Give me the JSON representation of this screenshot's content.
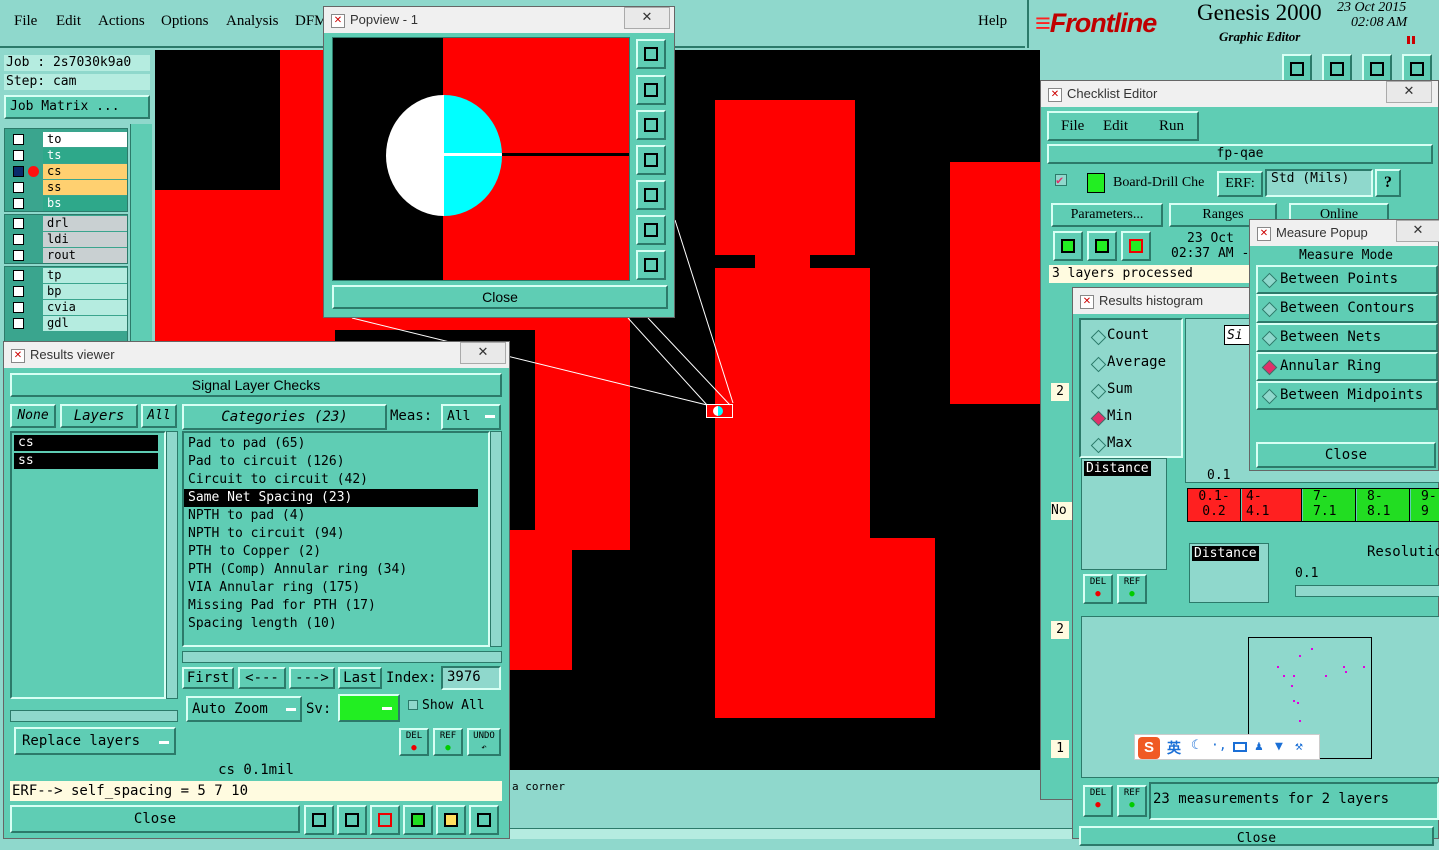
{
  "menubar": {
    "items": [
      "File",
      "Edit",
      "Actions",
      "Options",
      "Analysis",
      "DFM"
    ],
    "help": "Help"
  },
  "brand": {
    "logo": "Frontline",
    "product": "Genesis 2000",
    "subtitle": "Graphic Editor",
    "date": "23 Oct 2015",
    "time": "02:08 AM"
  },
  "job_panel": {
    "job": "Job : 2s7030k9a0",
    "step": "Step: cam",
    "job_matrix": "Job Matrix ...",
    "layers_group1": [
      "to",
      "ts",
      "cs",
      "ss",
      "bs"
    ],
    "layers_group2": [
      "drl",
      "ldi",
      "rout"
    ],
    "layers_group3": [
      "tp",
      "bp",
      "cvia",
      "gdl"
    ]
  },
  "popview": {
    "title": "Popview - 1",
    "close": "Close"
  },
  "results_viewer": {
    "title": "Results viewer",
    "header": "Signal Layer Checks",
    "none_btn": "None",
    "layers_label": "Layers",
    "all_btn": "All",
    "categories_label": "Categories (23)",
    "meas_label": "Meas:",
    "meas_value": "All",
    "layers": [
      "cs",
      "ss"
    ],
    "categories": [
      "Pad to pad (65)",
      "Pad to circuit (126)",
      "Circuit to circuit (42)",
      "Same Net Spacing (23)",
      "NPTH to pad (4)",
      "NPTH to circuit (94)",
      "PTH to Copper (2)",
      "PTH (Comp) Annular ring (34)",
      "VIA Annular ring (175)",
      "Missing Pad for PTH (17)",
      "Spacing length (10)"
    ],
    "selected_category": "Same Net Spacing (23)",
    "nav": {
      "first": "First",
      "prev": "<---",
      "next": "--->",
      "last": "Last",
      "index_label": "Index:",
      "index_value": "3976"
    },
    "auto_zoom": "Auto Zoom",
    "sv_label": "Sv:",
    "show_all": "Show All",
    "replace_layers": "Replace layers",
    "del": "DEL",
    "ref": "REF",
    "undo": "UNDO",
    "status": "cs 0.1mil",
    "erf_line": "ERF--> self_spacing = 5 7 10",
    "close": "Close"
  },
  "bottom_status": "a corner",
  "checklist_editor": {
    "title": "Checklist Editor",
    "menu": [
      "File",
      "Edit",
      "Run"
    ],
    "name": "fp-qae",
    "row_label": "Board-Drill Che",
    "erf_label": "ERF:",
    "erf_value": "Std (Mils)",
    "help": "?",
    "parameters": "Parameters...",
    "ranges": "Ranges",
    "online": "Online",
    "date": "23 Oct",
    "time": "02:37 AM -",
    "processed": "3 layers processed",
    "side_values": [
      "2",
      "No",
      "2",
      "1"
    ]
  },
  "histogram": {
    "title": "Results histogram",
    "modes": [
      "Count",
      "Average",
      "Sum",
      "Min",
      "Max"
    ],
    "selected_mode": "Min",
    "tab": "Si",
    "distance_label": "Distance",
    "axis_value": "0.1",
    "bins": [
      {
        "label": "0.1-",
        "sub": "0.2",
        "color": "#ff2020"
      },
      {
        "label": "4-",
        "sub": "4.1",
        "color": "#ff2020"
      },
      {
        "label": "7-",
        "sub": "7.1",
        "color": "#22dd22"
      },
      {
        "label": "8-",
        "sub": "8.1",
        "color": "#22dd22"
      },
      {
        "label": "9-",
        "sub": "9",
        "color": "#22dd22"
      }
    ],
    "resolution_label": "Resolutio",
    "resolution_value": "0.1",
    "del": "DEL",
    "ref": "REF",
    "measurements": "23 measurements for 2 layers",
    "close": "Close"
  },
  "measure_popup": {
    "title": "Measure Popup",
    "heading": "Measure Mode",
    "modes": [
      "Between Points",
      "Between Contours",
      "Between Nets",
      "Annular Ring",
      "Between Midpoints"
    ],
    "selected": "Annular Ring",
    "close": "Close"
  },
  "ime_bar": {
    "logo": "S",
    "lang": "英"
  },
  "colors": {
    "copper": "#ff0000",
    "canvas": "#000000",
    "panel": "#5fcdb4",
    "panel_light": "#8fd8cc",
    "pad_cyan": "#00ffff"
  }
}
